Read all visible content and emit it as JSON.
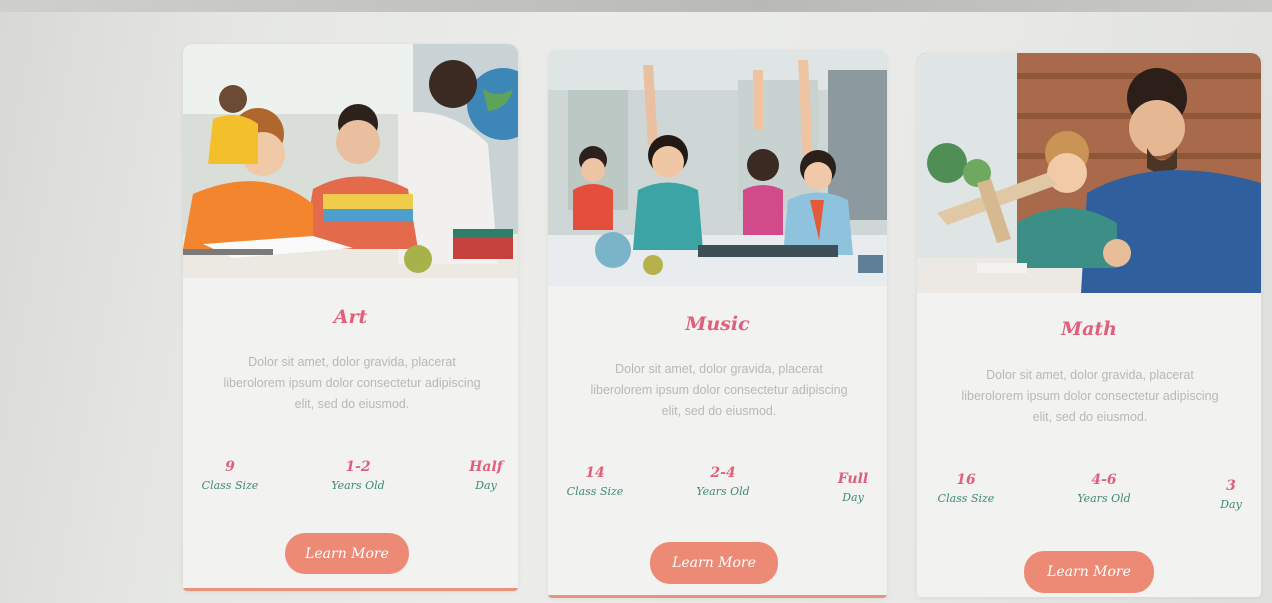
{
  "cards": [
    {
      "title": "Art",
      "photo": "children-drawing-with-teacher-photo",
      "description": "Dolor sit amet, dolor gravida, placerat liberolorem ipsum dolor consectetur adipiscing elit, sed do eiusmod.",
      "stats": [
        {
          "value": "9",
          "label": "Class Size"
        },
        {
          "value": "1-2",
          "label": "Years Old"
        },
        {
          "value": "Half",
          "label": "Day"
        }
      ],
      "button": "Learn More"
    },
    {
      "title": "Music",
      "photo": "students-raising-hands-photo",
      "description": "Dolor sit amet, dolor gravida, placerat liberolorem ipsum dolor consectetur adipiscing elit, sed do eiusmod.",
      "stats": [
        {
          "value": "14",
          "label": "Class Size"
        },
        {
          "value": "2-4",
          "label": "Years Old"
        },
        {
          "value": "Full",
          "label": "Day"
        }
      ],
      "button": "Learn More"
    },
    {
      "title": "Math",
      "photo": "father-and-son-building-plane-photo",
      "description": "Dolor sit amet, dolor gravida, placerat liberolorem ipsum dolor consectetur adipiscing elit, sed do eiusmod.",
      "stats": [
        {
          "value": "16",
          "label": "Class Size"
        },
        {
          "value": "4-6",
          "label": "Years Old"
        },
        {
          "value": "3",
          "label": "Day"
        }
      ],
      "button": "Learn More"
    }
  ],
  "colors": {
    "title": "#e0607c",
    "stat_label": "#3f8a74",
    "button": "#ec8a76",
    "accent_line": "#e9937e"
  }
}
